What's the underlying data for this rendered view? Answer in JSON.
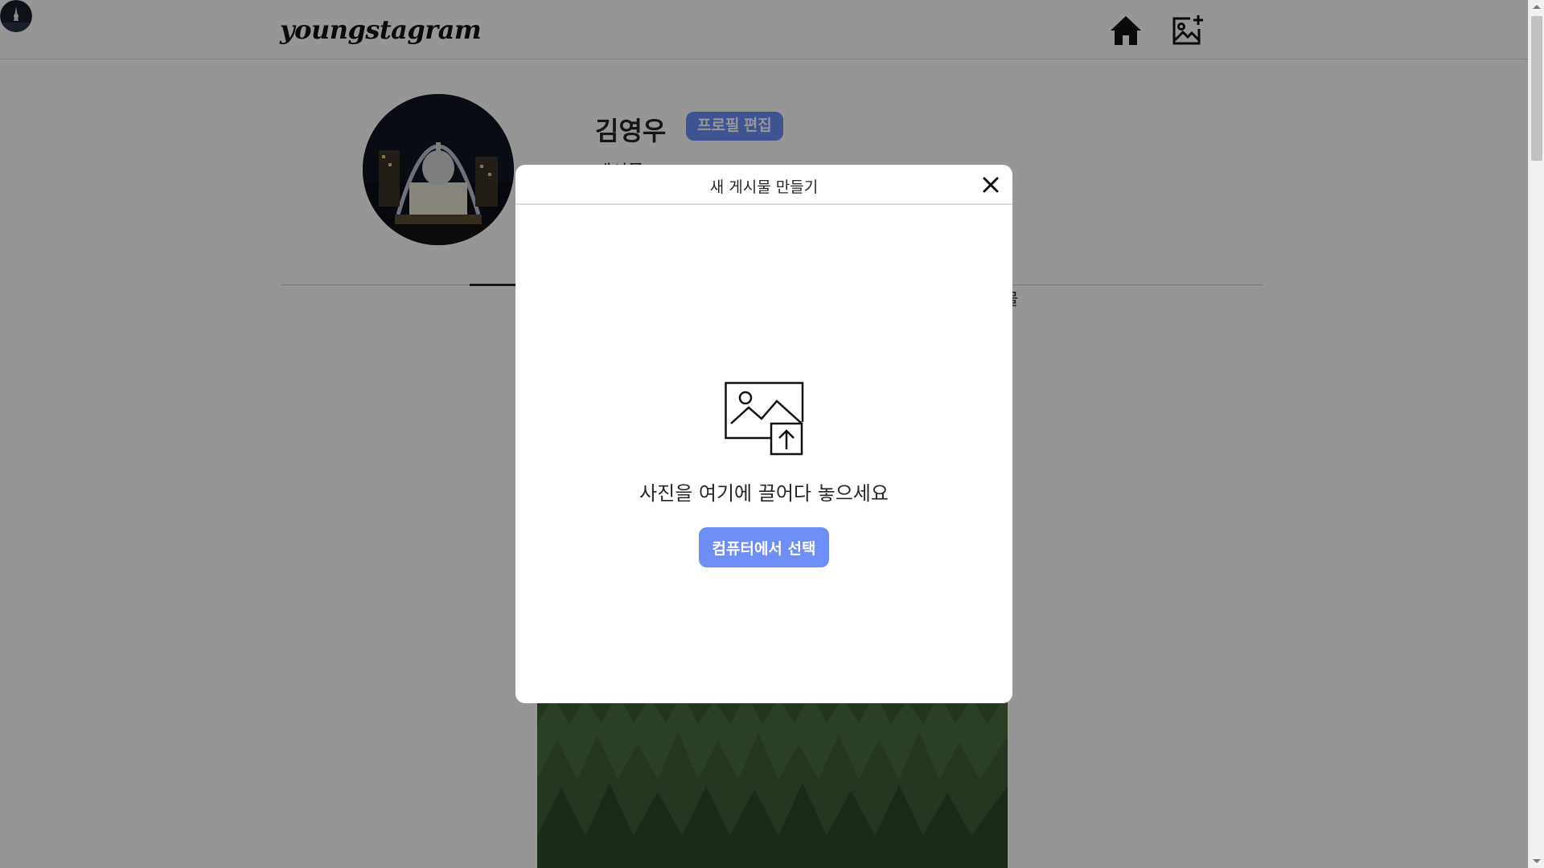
{
  "app": {
    "logo_text": "youngstagram"
  },
  "nav": {
    "home_icon": "home-icon",
    "add_post_icon": "add-image-icon",
    "avatar_icon": "profile-avatar"
  },
  "profile": {
    "name": "김영우",
    "edit_label": "프로필 편집",
    "sub_text": "게시물",
    "tab_right_label": "물"
  },
  "modal": {
    "title": "새 게시물 만들기",
    "drop_text": "사진을 여기에 끌어다 놓으세요",
    "select_label": "컴퓨터에서 선택"
  },
  "colors": {
    "accent": "#6c8ef5",
    "overlay": "#000000"
  }
}
